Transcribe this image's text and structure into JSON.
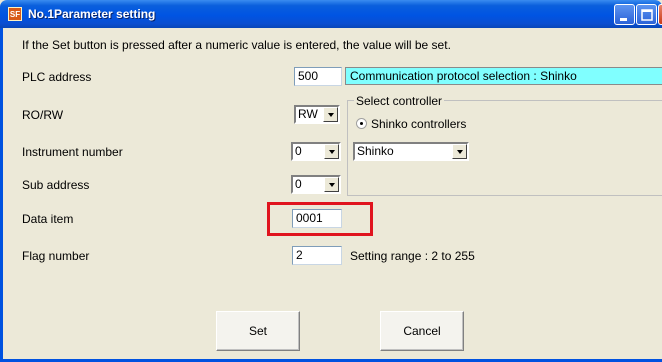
{
  "window": {
    "app_icon": "SF",
    "title": "No.1Parameter setting"
  },
  "instruction": "If the Set button is pressed after a numeric value is entered, the value will be set.",
  "fields": {
    "plc_address": {
      "label": "PLC address",
      "value": "500"
    },
    "ro_rw": {
      "label": "RO/RW",
      "value": "RW"
    },
    "instrument_number": {
      "label": "Instrument number",
      "value": "0"
    },
    "sub_address": {
      "label": "Sub address",
      "value": "0"
    },
    "data_item": {
      "label": "Data item",
      "value": "0001"
    },
    "flag_number": {
      "label": "Flag number",
      "value": "2",
      "hint": "Setting range : 2 to 255"
    }
  },
  "protocol_banner": "Communication protocol selection : Shinko",
  "select_controller": {
    "legend": "Select controller",
    "radio_label": "Shinko controllers",
    "radio_selected": true,
    "combo_value": "Shinko"
  },
  "buttons": {
    "set": "Set",
    "cancel": "Cancel"
  },
  "colors": {
    "title_bar": "#0054e3",
    "banner": "#80ffff",
    "highlight": "#e0141e",
    "dialog_bg": "#ece9d8"
  }
}
